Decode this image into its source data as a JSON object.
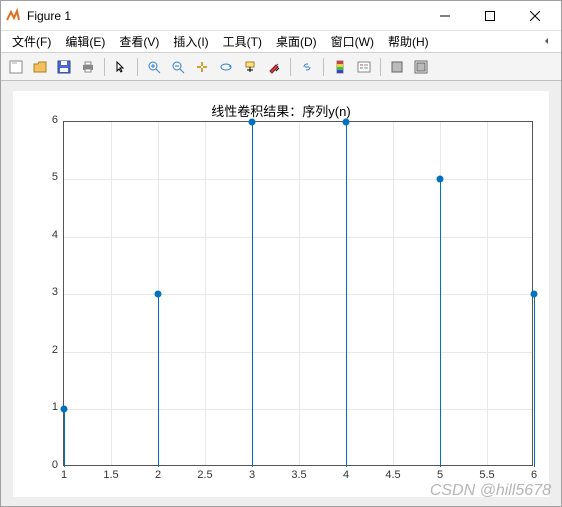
{
  "window": {
    "title": "Figure 1"
  },
  "menu": {
    "file": "文件(F)",
    "edit": "编辑(E)",
    "view": "查看(V)",
    "insert": "插入(I)",
    "tools": "工具(T)",
    "desktop": "桌面(D)",
    "window": "窗口(W)",
    "help": "帮助(H)"
  },
  "toolbar_icons": {
    "new": "new-figure-icon",
    "open": "open-file-icon",
    "save": "save-icon",
    "print": "print-icon",
    "pointer": "pointer-icon",
    "zoom_in": "zoom-in-icon",
    "zoom_out": "zoom-out-icon",
    "pan": "pan-icon",
    "rotate": "rotate-3d-icon",
    "datacursor": "data-cursor-icon",
    "brush": "brush-icon",
    "link": "link-icon",
    "colorbar": "colorbar-icon",
    "legend": "legend-icon",
    "hideplot": "hide-plot-tools-icon",
    "showplot": "show-plot-tools-icon"
  },
  "chart_data": {
    "type": "stem",
    "title": "线性卷积结果：序列y(n)",
    "x": [
      1,
      2,
      3,
      4,
      5,
      6
    ],
    "y": [
      1,
      3,
      6,
      6,
      5,
      3
    ],
    "xlim": [
      1,
      6
    ],
    "ylim": [
      0,
      6
    ],
    "xticks": [
      1,
      1.5,
      2,
      2.5,
      3,
      3.5,
      4,
      4.5,
      5,
      5.5,
      6
    ],
    "yticks": [
      0,
      1,
      2,
      3,
      4,
      5,
      6
    ],
    "grid": true,
    "marker_color": "#0072BD"
  },
  "watermark": "CSDN @hill5678"
}
